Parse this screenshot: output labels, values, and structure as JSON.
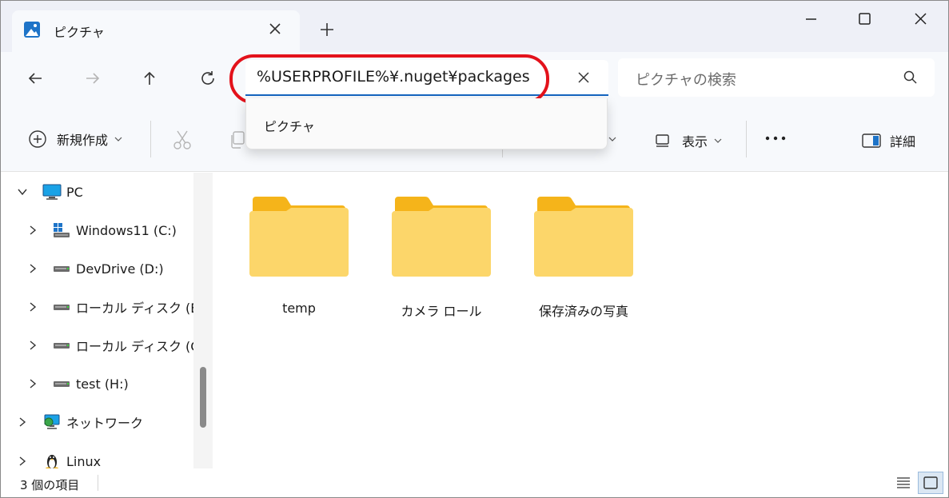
{
  "tab": {
    "title": "ピクチャ"
  },
  "address": {
    "value": "%USERPROFILE%¥.nuget¥packages",
    "suggestion": "ピクチャ"
  },
  "search": {
    "placeholder": "ピクチャの検索"
  },
  "toolbar": {
    "new_label": "新規作成",
    "view_label": "表示",
    "details_label": "詳細"
  },
  "sidebar": {
    "items": [
      {
        "label": "PC",
        "icon": "pc-icon",
        "expanded": true
      },
      {
        "label": "Windows11 (C:)",
        "icon": "windows-drive-icon"
      },
      {
        "label": "DevDrive (D:)",
        "icon": "drive-icon"
      },
      {
        "label": "ローカル ディスク (E:)",
        "icon": "drive-icon"
      },
      {
        "label": "ローカル ディスク (G:)",
        "icon": "drive-icon"
      },
      {
        "label": "test (H:)",
        "icon": "drive-icon"
      },
      {
        "label": "ネットワーク",
        "icon": "network-icon"
      },
      {
        "label": "Linux",
        "icon": "linux-icon"
      }
    ]
  },
  "folders": [
    {
      "name": "temp"
    },
    {
      "name": "カメラ ロール"
    },
    {
      "name": "保存済みの写真"
    }
  ],
  "status": {
    "count_text": "3 個の項目"
  },
  "colors": {
    "accent": "#1565c0",
    "annotation": "#e3121b",
    "folder": "#f9c93e"
  }
}
